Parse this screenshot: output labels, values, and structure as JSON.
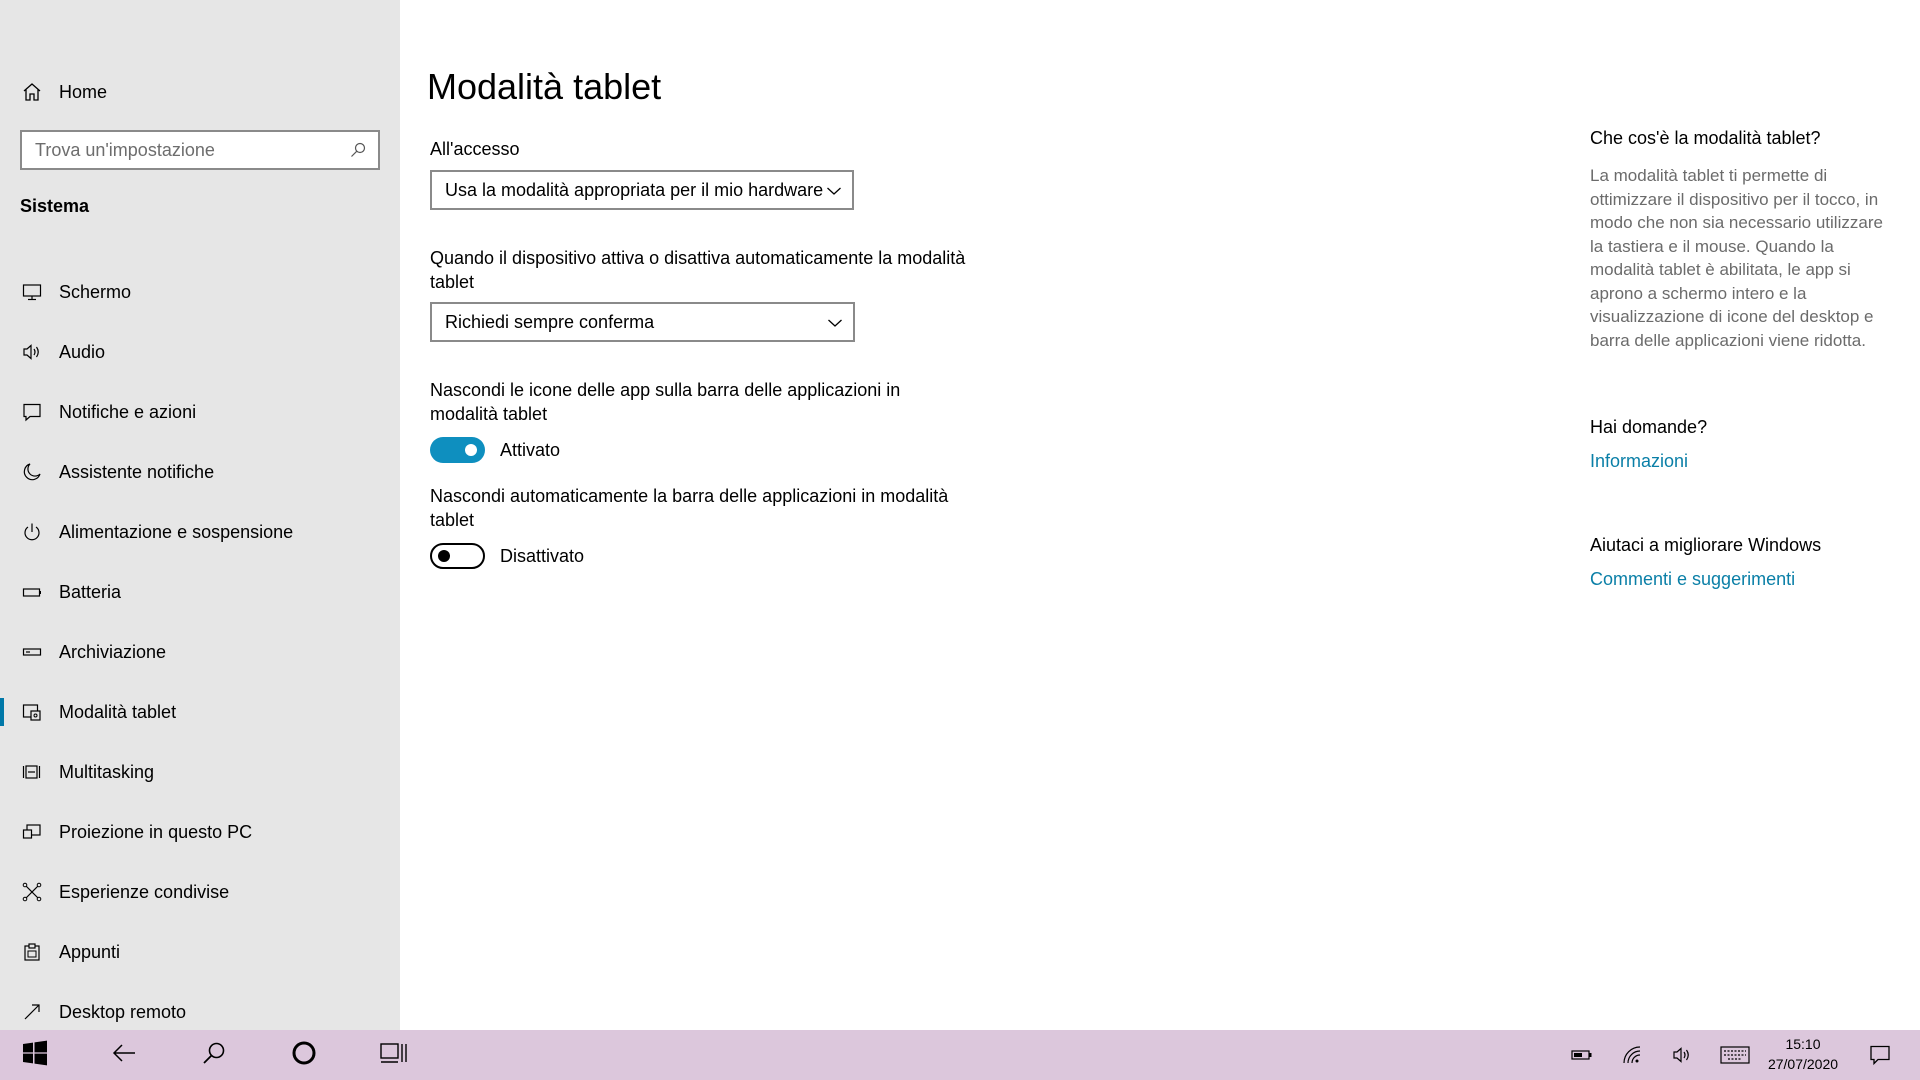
{
  "sidebar": {
    "home_label": "Home",
    "search_placeholder": "Trova un'impostazione",
    "section_title": "Sistema",
    "items": [
      {
        "label": "Schermo",
        "icon": "monitor-icon"
      },
      {
        "label": "Audio",
        "icon": "speaker-icon"
      },
      {
        "label": "Notifiche e azioni",
        "icon": "message-icon"
      },
      {
        "label": "Assistente notifiche",
        "icon": "moon-icon"
      },
      {
        "label": "Alimentazione e sospensione",
        "icon": "power-icon"
      },
      {
        "label": "Batteria",
        "icon": "battery-icon"
      },
      {
        "label": "Archiviazione",
        "icon": "storage-icon"
      },
      {
        "label": "Modalità tablet",
        "icon": "tablet-mode-icon",
        "selected": true
      },
      {
        "label": "Multitasking",
        "icon": "multitasking-icon"
      },
      {
        "label": "Proiezione in questo PC",
        "icon": "projection-icon"
      },
      {
        "label": "Esperienze condivise",
        "icon": "shared-experiences-icon"
      },
      {
        "label": "Appunti",
        "icon": "clipboard-icon"
      },
      {
        "label": "Desktop remoto",
        "icon": "remote-desktop-icon"
      }
    ]
  },
  "main": {
    "title": "Modalità tablet",
    "signin": {
      "label": "All'accesso",
      "value": "Usa la modalità appropriata per il mio hardware"
    },
    "auto_switch": {
      "label": "Quando il dispositivo attiva o disattiva automaticamente la modalità tablet",
      "value": "Richiedi sempre conferma"
    },
    "hide_icons": {
      "label": "Nascondi le icone delle app sulla barra delle applicazioni in modalità tablet",
      "state": "Attivato",
      "on": true
    },
    "hide_taskbar": {
      "label": "Nascondi automaticamente la barra delle applicazioni in modalità tablet",
      "state": "Disattivato",
      "on": false
    }
  },
  "right_pane": {
    "what_heading": "Che cos'è la modalità tablet?",
    "what_desc": "La modalità tablet ti permette di ottimizzare il dispositivo per il tocco, in modo che non sia necessario utilizzare la tastiera e il mouse. Quando la modalità tablet è abilitata, le app si aprono a schermo intero e la visualizzazione di icone del desktop e barra delle applicazioni viene ridotta.",
    "questions_heading": "Hai domande?",
    "questions_link": "Informazioni",
    "improve_heading": "Aiutaci a migliorare Windows",
    "improve_link": "Commenti e suggerimenti"
  },
  "taskbar": {
    "time": "15:10",
    "date": "27/07/2020"
  },
  "colors": {
    "accent": "#0e8fbf",
    "link": "#0a7fa7",
    "sidebar_bg": "#e6e6e6",
    "taskbar_bg": "#dcc7dc"
  }
}
